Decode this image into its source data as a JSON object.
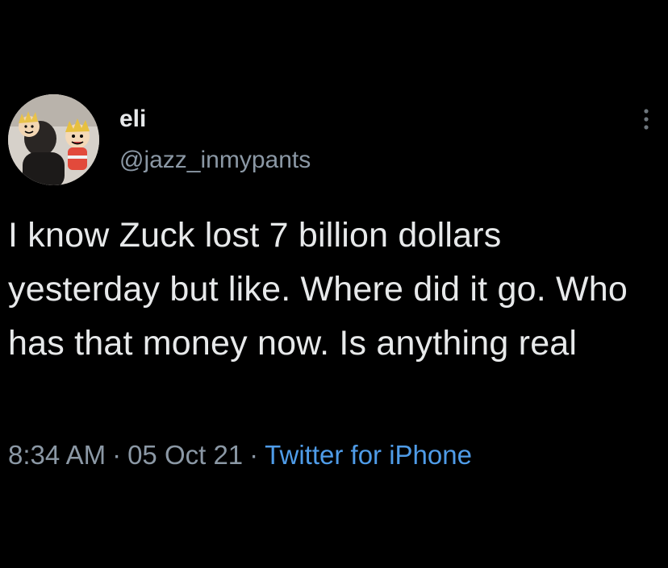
{
  "tweet": {
    "author": {
      "display_name": "eli",
      "handle": "@jazz_inmypants",
      "avatar_icon": "avatar-icon"
    },
    "text": "I know Zuck lost 7 billion dollars yesterday but like. Where did it go. Who has that money now. Is anything real",
    "meta": {
      "time": "8:34 AM",
      "separator": "·",
      "date": "05 Oct 21",
      "source": "Twitter for iPhone"
    },
    "more_icon": "more-options-icon"
  },
  "colors": {
    "background": "#000000",
    "primary_text": "#e7e9ea",
    "secondary_text": "#8b98a5",
    "link": "#4f9ce8"
  }
}
